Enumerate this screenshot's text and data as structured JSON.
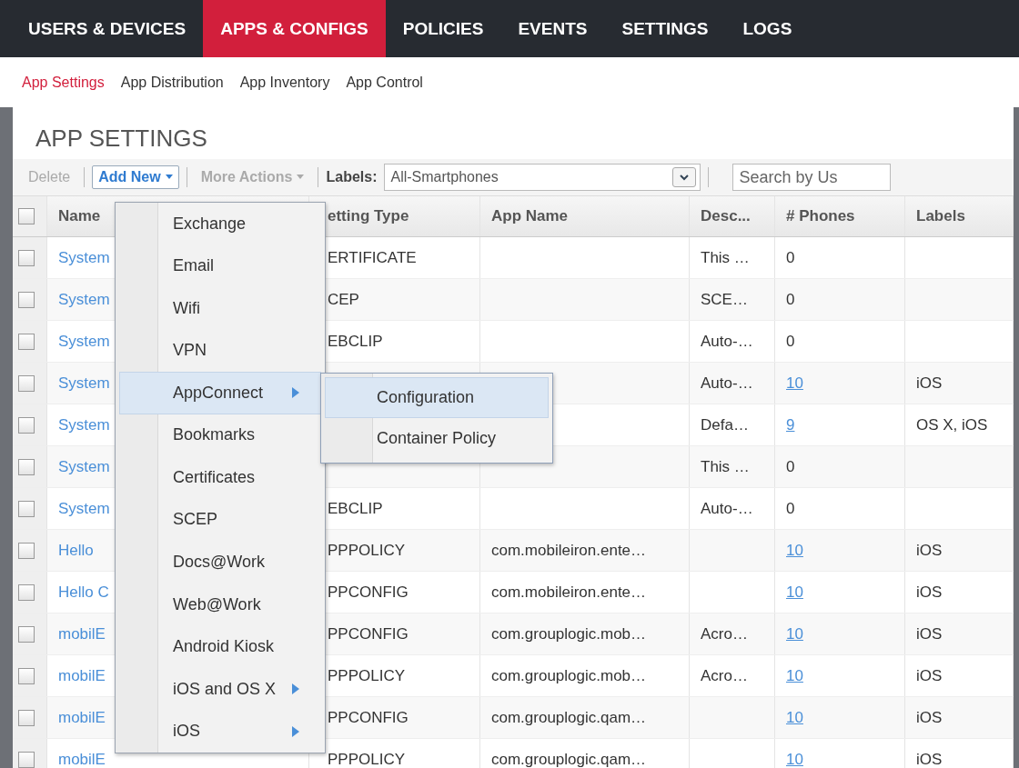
{
  "nav_tabs": [
    {
      "label": "USERS & DEVICES",
      "selected": false
    },
    {
      "label": "APPS & CONFIGS",
      "selected": true
    },
    {
      "label": "POLICIES",
      "selected": false
    },
    {
      "label": "EVENTS",
      "selected": false
    },
    {
      "label": "SETTINGS",
      "selected": false
    },
    {
      "label": "LOGS",
      "selected": false
    }
  ],
  "sub_tabs": [
    {
      "label": "App Settings",
      "selected": true
    },
    {
      "label": "App Distribution",
      "selected": false
    },
    {
      "label": "App Inventory",
      "selected": false
    },
    {
      "label": "App Control",
      "selected": false
    }
  ],
  "page_title": "APP SETTINGS",
  "toolbar": {
    "delete": {
      "label": "Delete",
      "disabled": true
    },
    "add_new": {
      "label": "Add New",
      "disabled": false
    },
    "more_actions": {
      "label": "More Actions",
      "disabled": true
    },
    "labels_label": "Labels:",
    "labels_value": "All-Smartphones",
    "search_placeholder": "Search by Us"
  },
  "table": {
    "header_checked": false,
    "columns": [
      "Name",
      "etting Type",
      "App Name",
      "Desc...",
      "# Phones",
      "Labels"
    ],
    "rows": [
      {
        "checked": false,
        "name": "System",
        "setting_type": "ERTIFICATE",
        "description": "This …",
        "phones": "0",
        "phones_link": false
      },
      {
        "checked": false,
        "name": "System",
        "setting_type": "CEP",
        "description": "SCE…",
        "phones": "0",
        "phones_link": false
      },
      {
        "checked": false,
        "name": "System",
        "setting_type": "EBCLIP",
        "description": "Auto-…",
        "phones": "0",
        "phones_link": false
      },
      {
        "checked": false,
        "name": "System",
        "description": "Auto-…",
        "phones": "10",
        "phones_link": true,
        "labels": "iOS"
      },
      {
        "checked": false,
        "name": "System",
        "description": "Defa…",
        "phones": "9",
        "phones_link": true,
        "labels": "OS X, iOS"
      },
      {
        "checked": false,
        "name": "System",
        "description": "This …",
        "phones": "0",
        "phones_link": false
      },
      {
        "checked": false,
        "name": "System",
        "setting_type": "EBCLIP",
        "description": "Auto-…",
        "phones": "0",
        "phones_link": false
      },
      {
        "checked": false,
        "name": "Hello",
        "setting_type": "PPPOLICY",
        "app_name": "com.mobileiron.ente…",
        "phones": "10",
        "phones_link": true,
        "labels": "iOS"
      },
      {
        "checked": false,
        "name": "Hello C",
        "setting_type": "PPCONFIG",
        "app_name": "com.mobileiron.ente…",
        "phones": "10",
        "phones_link": true,
        "labels": "iOS"
      },
      {
        "checked": false,
        "name": "mobilE",
        "setting_type": "PPCONFIG",
        "app_name": "com.grouplogic.mob…",
        "description": "Acro…",
        "phones": "10",
        "phones_link": true,
        "labels": "iOS"
      },
      {
        "checked": false,
        "name": "mobilE",
        "setting_type": "PPPOLICY",
        "app_name": "com.grouplogic.mob…",
        "description": "Acro…",
        "phones": "10",
        "phones_link": true,
        "labels": "iOS"
      },
      {
        "checked": false,
        "name": "mobilE",
        "setting_type": "PPCONFIG",
        "app_name": "com.grouplogic.qam…",
        "phones": "10",
        "phones_link": true,
        "labels": "iOS"
      },
      {
        "checked": false,
        "name": "mobilE",
        "setting_type": "PPPOLICY",
        "app_name": "com.grouplogic.qam…",
        "phones": "10",
        "phones_link": true,
        "labels": "iOS"
      }
    ]
  },
  "add_new_menu": {
    "items": [
      {
        "label": "Exchange",
        "selected": false,
        "submenu": false
      },
      {
        "label": "Email",
        "selected": false,
        "submenu": false
      },
      {
        "label": "Wifi",
        "selected": false,
        "submenu": false
      },
      {
        "label": "VPN",
        "selected": false,
        "submenu": false
      },
      {
        "label": "AppConnect",
        "selected": true,
        "submenu": true
      },
      {
        "label": "Bookmarks",
        "selected": false,
        "submenu": false
      },
      {
        "label": "Certificates",
        "selected": false,
        "submenu": false
      },
      {
        "label": "SCEP",
        "selected": false,
        "submenu": false
      },
      {
        "label": "Docs@Work",
        "selected": false,
        "submenu": false
      },
      {
        "label": "Web@Work",
        "selected": false,
        "submenu": false
      },
      {
        "label": "Android Kiosk",
        "selected": false,
        "submenu": false
      },
      {
        "label": "iOS and OS X",
        "selected": false,
        "submenu": true
      },
      {
        "label": "iOS",
        "selected": false,
        "submenu": true
      }
    ]
  },
  "submenu": {
    "items": [
      {
        "label": "Configuration",
        "selected": true
      },
      {
        "label": "Container Policy",
        "selected": false
      }
    ]
  }
}
